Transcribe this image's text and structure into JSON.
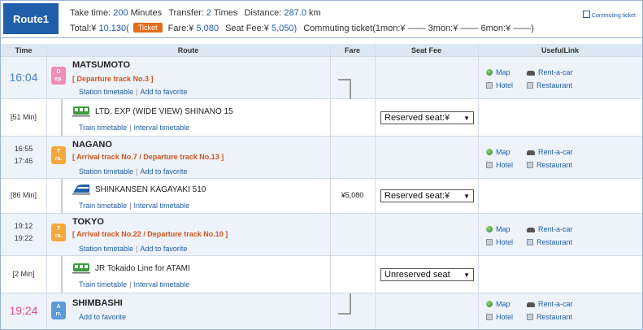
{
  "summary": {
    "route_label": "Route1",
    "take_time_label": "Take time:",
    "take_time_value": "200",
    "minutes_label": "Minutes",
    "transfer_label": "Transfer:",
    "transfer_value": "2",
    "times_label": "Times",
    "distance_label": "Distance:",
    "distance_value": "287.0",
    "km_label": "km",
    "total_label": "Total:¥",
    "total_value": "10,130",
    "ticket_button": "Ticket",
    "fare_label": "Fare:¥",
    "fare_value": "5,080",
    "seat_fee_label": "Seat Fee:¥",
    "seat_fee_value": "5,050",
    "commuting_text": "Commuting ticket(1mon:¥ ―― 3mon:¥ ―― 6mon:¥ ――)",
    "commuting_link": "Commuting ticket"
  },
  "headers": {
    "time": "Time",
    "route": "Route",
    "fare": "Fare",
    "seat_fee": "Seat Fee",
    "useful": "UsefulLink"
  },
  "links": {
    "map": "Map",
    "rent": "Rent-a-car",
    "hotel": "Hotel",
    "restaurant": "Restaurant"
  },
  "stations": [
    {
      "time": "16:04",
      "badge_top": "D",
      "badge_bottom": "ep.",
      "name": "MATSUMOTO",
      "track": "[ Departure track No.3 ]",
      "link1": "Station timetable",
      "link2": "Add to favorite"
    },
    {
      "time_arr": "16:55",
      "time_dep": "17:46",
      "badge_top": "T",
      "badge_bottom": "ra.",
      "name": "NAGANO",
      "track": "[ Arrival track No.7 / Departure track No.13 ]",
      "link1": "Station timetable",
      "link2": "Add to favorite"
    },
    {
      "time_arr": "19:12",
      "time_dep": "19:22",
      "badge_top": "T",
      "badge_bottom": "ra.",
      "name": "TOKYO",
      "track": "[ Arrival track No.22 / Departure track No.10 ]",
      "link1": "Station timetable",
      "link2": "Add to favorite"
    },
    {
      "time": "19:24",
      "badge_top": "A",
      "badge_bottom": "rr.",
      "name": "SHIMBASHI",
      "link1": "Add to favorite"
    }
  ],
  "segments": [
    {
      "duration": "[51 Min]",
      "train": "LTD. EXP (WIDE VIEW) SHINANO 15",
      "link1": "Train timetable",
      "link2": "Interval timetable",
      "fare": "",
      "seat": "Reserved seat:¥",
      "icon_color": "#3d9a3d"
    },
    {
      "duration": "[86 Min]",
      "train": "SHINKANSEN KAGAYAKI 510",
      "link1": "Train timetable",
      "link2": "Interval timetable",
      "fare": "¥5,080",
      "seat": "Reserved seat:¥",
      "icon_color": "#1f5ea8"
    },
    {
      "duration": "[2 Min]",
      "train": "JR Tokaido Line  for ATAMI",
      "link1": "Train timetable",
      "link2": "Interval timetable",
      "fare": "",
      "seat": "Unreserved seat",
      "icon_color": "#3d9a3d"
    }
  ]
}
